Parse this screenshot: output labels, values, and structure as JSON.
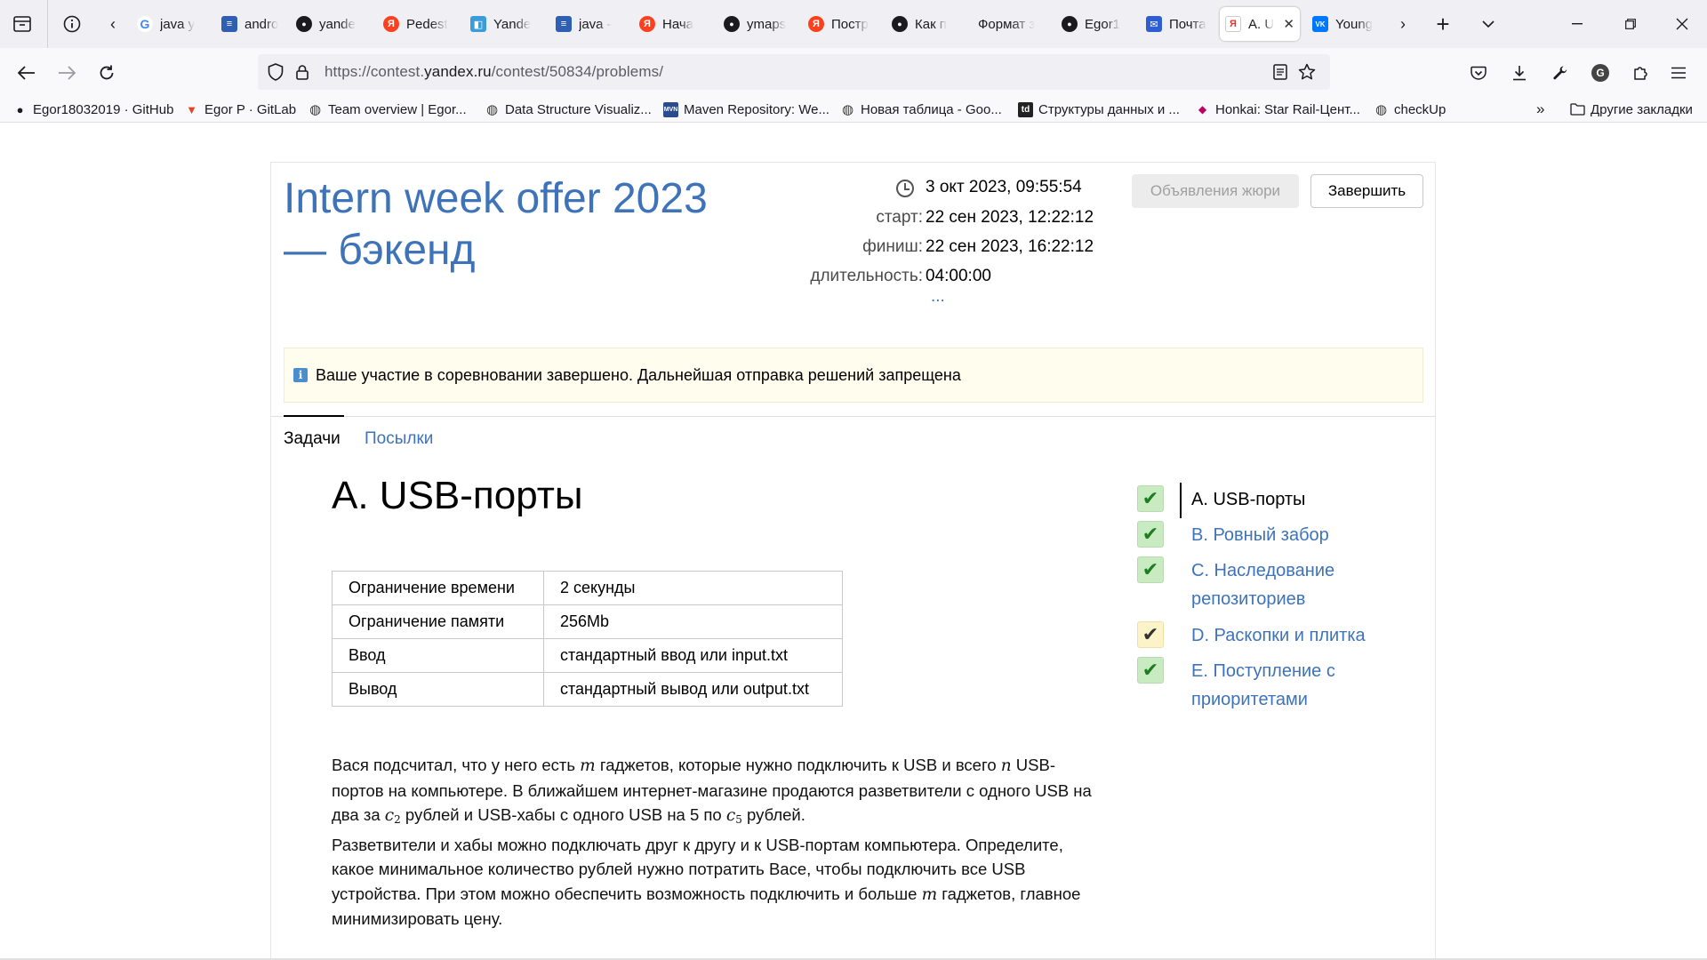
{
  "browser": {
    "tabs": [
      {
        "label": "java y",
        "icon": "google-icon",
        "color": "#4285f4"
      },
      {
        "label": "andro",
        "icon": "stackoverflow-icon",
        "color": "#2f5fb3"
      },
      {
        "label": "yande",
        "icon": "github-icon",
        "color": "#1b1b1f"
      },
      {
        "label": "Pedest",
        "icon": "yandex-icon",
        "color": "#fc3f1d"
      },
      {
        "label": "Yande",
        "icon": "yandex-tracker-icon",
        "color": "#3b9cd9"
      },
      {
        "label": "java -",
        "icon": "stackoverflow-icon",
        "color": "#2f5fb3"
      },
      {
        "label": "Нача",
        "icon": "yandex-icon",
        "color": "#fc3f1d"
      },
      {
        "label": "ymaps",
        "icon": "github-icon",
        "color": "#1b1b1f"
      },
      {
        "label": "Постр",
        "icon": "yandex-icon",
        "color": "#fc3f1d"
      },
      {
        "label": "Как п",
        "icon": "github-icon",
        "color": "#1b1b1f"
      },
      {
        "label": "Формат з",
        "icon": "none",
        "color": "#f0f0f4"
      },
      {
        "label": "Egor1",
        "icon": "github-icon",
        "color": "#1b1b1f"
      },
      {
        "label": "Почта",
        "icon": "mail-icon",
        "color": "#2e5fd1"
      },
      {
        "label": "A. U",
        "icon": "yandex-contest-icon",
        "color": "#e0e0e0",
        "active": true
      },
      {
        "label": "Young",
        "icon": "vk-icon",
        "color": "#0077ff"
      }
    ],
    "url_prefix": "https://contest.",
    "url_domain": "yandex.ru",
    "url_path": "/contest/50834/problems/",
    "bookmarks": [
      {
        "label": "Egor18032019 · GitHub",
        "icon": "github-icon"
      },
      {
        "label": "Egor P · GitLab",
        "icon": "gitlab-icon"
      },
      {
        "label": "Team overview | Egor...",
        "icon": "globe-icon"
      },
      {
        "label": "Data Structure Visualiz...",
        "icon": "globe-icon"
      },
      {
        "label": "Maven Repository: We...",
        "icon": "maven-icon"
      },
      {
        "label": "Новая таблица - Goo...",
        "icon": "globe-icon"
      },
      {
        "label": "Структуры данных и ...",
        "icon": "td-icon"
      },
      {
        "label": "Honkai: Star Rail-Цент...",
        "icon": "honkai-icon"
      },
      {
        "label": "checkUp",
        "icon": "globe-icon"
      }
    ],
    "other_bookmarks": "Другие закладки"
  },
  "contest": {
    "title": "Intern week offer 2023 — бэкенд",
    "now": "3 окт 2023, 09:55:54",
    "start_label": "старт:",
    "start": "22 сен 2023, 12:22:12",
    "finish_label": "финиш:",
    "finish": "22 сен 2023, 16:22:12",
    "duration_label": "длительность:",
    "duration": "04:00:00",
    "more": "...",
    "jury_button": "Объявления жюри",
    "finish_button": "Завершить",
    "notice": "Ваше участие в соревновании завершено. Дальнейшая отправка решений запрещена",
    "tabs": [
      "Задачи",
      "Посылки"
    ]
  },
  "problem": {
    "title": "A. USB-порты",
    "limits": [
      {
        "key": "Ограничение времени",
        "value": "2 секунды"
      },
      {
        "key": "Ограничение памяти",
        "value": "256Mb"
      },
      {
        "key": "Ввод",
        "value": "стандартный ввод или input.txt"
      },
      {
        "key": "Вывод",
        "value": "стандартный вывод или output.txt"
      }
    ],
    "statement": {
      "p1a": "Вася подсчитал, что у него есть ",
      "v_m": "m",
      "p1b": " гаджетов, которые нужно подключить к USB и всего ",
      "v_n": "n",
      "p1c": " USB-портов на компьютере. В ближайшем интернет-магазине продаются разветвители с одного USB на два за ",
      "v_c": "c",
      "sub2": "2",
      "p1d": " рублей и USB-хабы с одного USB на 5 по ",
      "sub5": "5",
      "p1e": " рублей.",
      "p2a": "Разветвители и хабы можно подключать друг к другу и к USB-портам компьютера. Определите, какое минимальное количество рублей нужно потратить Васе, чтобы подключить все USB устройства. При этом можно обеспечить возможность подключить и больше ",
      "p2b": " гаджетов, главное минимизировать цену."
    }
  },
  "problem_list": [
    {
      "label": "A. USB-порты",
      "status": "accepted",
      "current": true
    },
    {
      "label": "B. Ровный забор",
      "status": "accepted"
    },
    {
      "label": "C. Наследование репозиториев",
      "status": "accepted"
    },
    {
      "label": "D. Раскопки и плитка",
      "status": "pending"
    },
    {
      "label": "E. Поступление с приоритетами",
      "status": "accepted"
    }
  ]
}
